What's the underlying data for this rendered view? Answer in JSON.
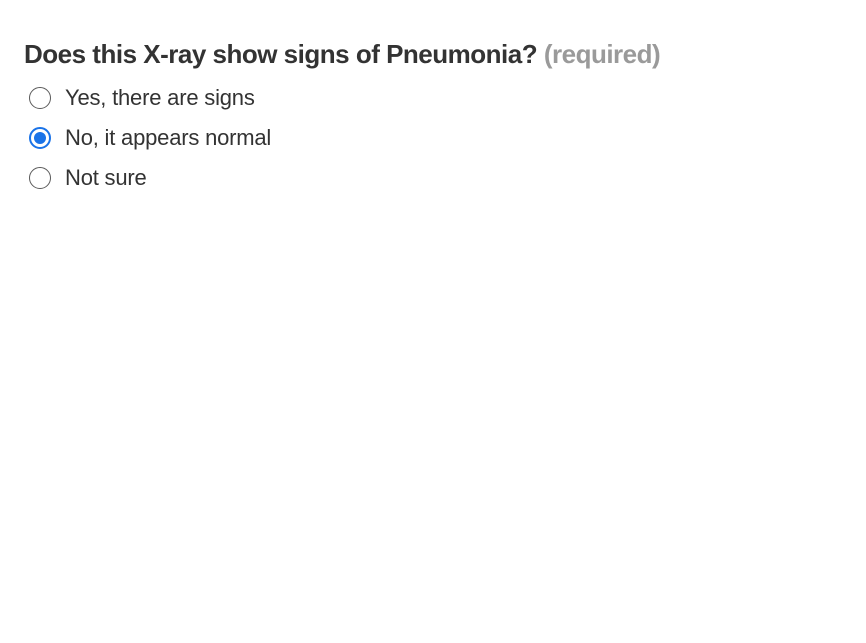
{
  "question": {
    "title": "Does this X-ray show signs of Pneumonia?",
    "required_label": "(required)",
    "options": [
      {
        "label": "Yes, there are signs",
        "checked": false
      },
      {
        "label": "No, it appears normal",
        "checked": true
      },
      {
        "label": "Not sure",
        "checked": false
      }
    ]
  },
  "colors": {
    "accent": "#1a73e8",
    "text": "#333333",
    "muted": "#9a9a9a"
  }
}
